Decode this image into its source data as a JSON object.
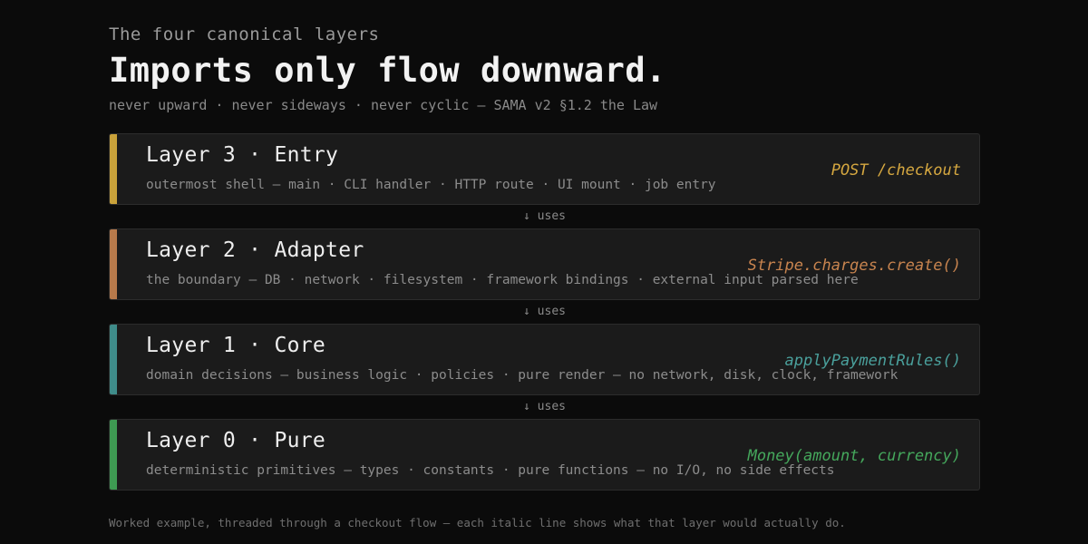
{
  "header": {
    "kicker": "The four canonical layers",
    "headline": "Imports only flow downward.",
    "subline": "never upward · never sideways · never cyclic — SAMA v2 §1.2 the Law"
  },
  "layers": [
    {
      "title": "Layer 3 · Entry",
      "description": "outermost shell — main · CLI handler · HTTP route · UI mount · job entry",
      "example": "POST /checkout",
      "accent_color": "#c9a23a",
      "example_color": "#d6a840"
    },
    {
      "title": "Layer 2 · Adapter",
      "description": "the boundary — DB · network · filesystem · framework bindings · external input parsed here",
      "example": "Stripe.charges.create()",
      "accent_color": "#b87a4b",
      "example_color": "#c8844f"
    },
    {
      "title": "Layer 1 · Core",
      "description": "domain decisions — business logic · policies · pure render — no network, disk, clock, framework",
      "example": "applyPaymentRules()",
      "accent_color": "#3f8c8a",
      "example_color": "#4aa09c"
    },
    {
      "title": "Layer 0 · Pure",
      "description": "deterministic primitives — types · constants · pure functions — no I/O, no side effects",
      "example": "Money(amount, currency)",
      "accent_color": "#3e9a52",
      "example_color": "#45a85c"
    }
  ],
  "connectors": {
    "label": "↓ uses"
  },
  "footnote": "Worked example, threaded through a checkout flow — each italic line shows what that layer would actually do."
}
